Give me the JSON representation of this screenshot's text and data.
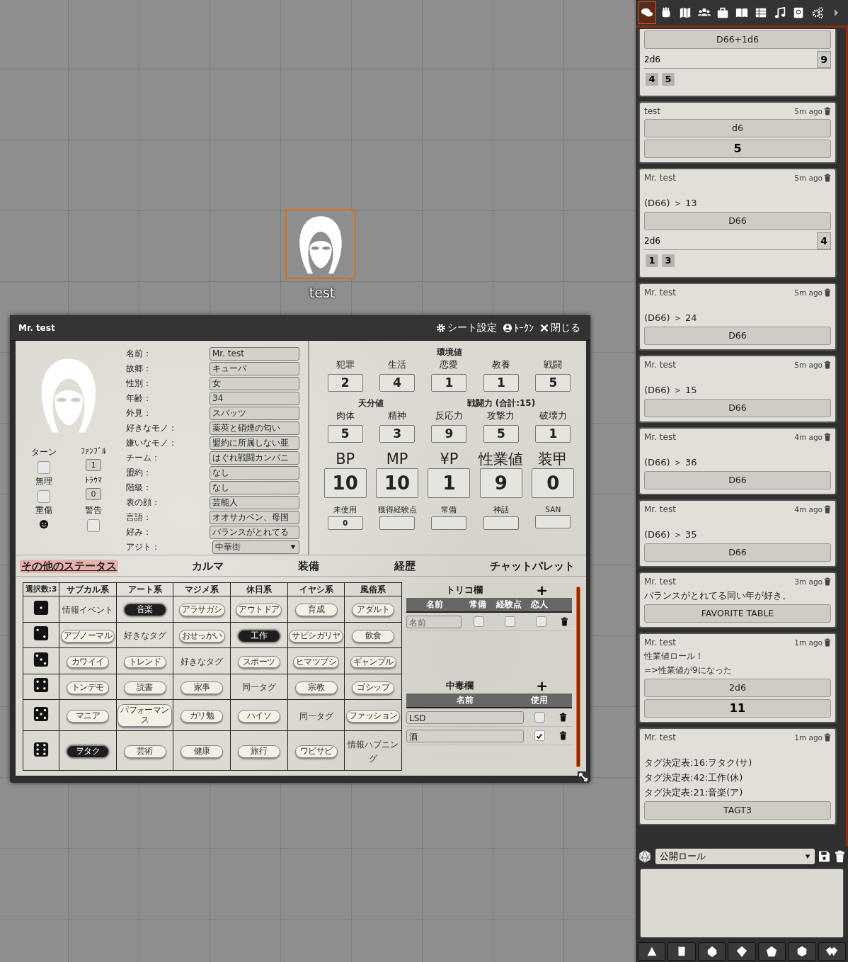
{
  "canvas": {
    "token": {
      "label": "test"
    }
  },
  "sheet": {
    "title": "Mr. test",
    "actions": [
      {
        "kind": "gear",
        "label": "シート設定"
      },
      {
        "kind": "user",
        "label": "ﾄｰｸﾝ"
      },
      {
        "kind": "close",
        "label": "閉じる"
      }
    ],
    "counters": [
      {
        "label": "ターン",
        "kind": "checkbox",
        "checked": false
      },
      {
        "label": "ﾌｧﾝﾌﾞﾙ",
        "kind": "number",
        "value": "1"
      },
      {
        "label": "無理",
        "kind": "checkbox",
        "checked": false
      },
      {
        "label": "ﾄﾗｳﾏ",
        "kind": "number",
        "value": "0"
      },
      {
        "label": "重傷",
        "kind": "icon"
      },
      {
        "label": "警告",
        "kind": "checkbox",
        "checked": false
      }
    ],
    "profile": [
      {
        "label": "名前：",
        "value": "Mr. test",
        "kind": "text"
      },
      {
        "label": "故郷：",
        "value": "キューバ",
        "kind": "text"
      },
      {
        "label": "性別：",
        "value": "女",
        "kind": "text"
      },
      {
        "label": "年齢：",
        "value": "34",
        "kind": "text"
      },
      {
        "label": "外見：",
        "value": "スパッツ",
        "kind": "text"
      },
      {
        "label": "好きなモノ：",
        "value": "薬莢と硝煙の匂い",
        "kind": "text"
      },
      {
        "label": "嫌いなモノ：",
        "value": "盟約に所属しない亜",
        "kind": "text"
      },
      {
        "label": "チーム：",
        "value": "はぐれ戦闘カンパニ",
        "kind": "text"
      },
      {
        "label": "盟約：",
        "value": "なし",
        "kind": "text"
      },
      {
        "label": "階級：",
        "value": "なし",
        "kind": "text"
      },
      {
        "label": "表の顔：",
        "value": "芸能人",
        "kind": "text"
      },
      {
        "label": "言語：",
        "value": "オオサカベン、母国",
        "kind": "text"
      },
      {
        "label": "好み：",
        "value": "バランスがとれてる",
        "kind": "text"
      },
      {
        "label": "アジト：",
        "value": "中華街",
        "kind": "select"
      }
    ],
    "environment": {
      "title": "環境値",
      "stats": [
        {
          "label": "犯罪",
          "value": "2"
        },
        {
          "label": "生活",
          "value": "4"
        },
        {
          "label": "恋愛",
          "value": "1"
        },
        {
          "label": "教養",
          "value": "1"
        },
        {
          "label": "戦闘",
          "value": "5"
        }
      ]
    },
    "aptitude": {
      "title": "天分値",
      "stats": [
        {
          "label": "肉体",
          "value": "5"
        },
        {
          "label": "精神",
          "value": "3"
        }
      ]
    },
    "combat": {
      "title": "戦闘力 (合計:15)",
      "stats": [
        {
          "label": "反応力",
          "value": "9"
        },
        {
          "label": "攻撃力",
          "value": "5"
        },
        {
          "label": "破壊力",
          "value": "1"
        }
      ]
    },
    "points": [
      {
        "label": "BP",
        "value": "10"
      },
      {
        "label": "MP",
        "value": "10"
      },
      {
        "label": "¥P",
        "value": "1"
      },
      {
        "label": "性業値",
        "value": "9"
      },
      {
        "label": "装甲",
        "value": "0"
      }
    ],
    "extras": [
      {
        "label": "未使用",
        "value": "0"
      },
      {
        "label": "獲得経験点"
      },
      {
        "label": "常備"
      },
      {
        "label": "神話"
      },
      {
        "label": "SAN"
      }
    ],
    "tabs": [
      {
        "label": "その他のステータス",
        "selected": true
      },
      {
        "label": "カルマ",
        "selected": false
      },
      {
        "label": "装備",
        "selected": false
      },
      {
        "label": "経歴",
        "selected": false
      },
      {
        "label": "チャットパレット",
        "selected": false
      }
    ],
    "tag_table": {
      "corner": "選択数:3",
      "columns": [
        "サブカル系",
        "アート系",
        "マジメ系",
        "休日系",
        "イヤシ系",
        "風俗系"
      ],
      "rows": [
        [
          {
            "text": "情報イベント",
            "kind": "text"
          },
          {
            "text": "音楽",
            "kind": "tag",
            "selected": true
          },
          {
            "text": "アラサガシ",
            "kind": "tag",
            "selected": false
          },
          {
            "text": "アウトドア",
            "kind": "tag",
            "selected": false
          },
          {
            "text": "育成",
            "kind": "tag",
            "selected": false
          },
          {
            "text": "アダルト",
            "kind": "tag",
            "selected": false
          }
        ],
        [
          {
            "text": "アブノーマル",
            "kind": "tag",
            "selected": false
          },
          {
            "text": "好きなタグ",
            "kind": "text"
          },
          {
            "text": "おせっかい",
            "kind": "tag",
            "selected": false
          },
          {
            "text": "工作",
            "kind": "tag",
            "selected": true
          },
          {
            "text": "サビシガリヤ",
            "kind": "tag",
            "selected": false
          },
          {
            "text": "飲食",
            "kind": "tag",
            "selected": false
          }
        ],
        [
          {
            "text": "カワイイ",
            "kind": "tag",
            "selected": false
          },
          {
            "text": "トレンド",
            "kind": "tag",
            "selected": false
          },
          {
            "text": "好きなタグ",
            "kind": "text"
          },
          {
            "text": "スポーツ",
            "kind": "tag",
            "selected": false
          },
          {
            "text": "ヒマツブシ",
            "kind": "tag",
            "selected": false
          },
          {
            "text": "ギャンブル",
            "kind": "tag",
            "selected": false
          }
        ],
        [
          {
            "text": "トンデモ",
            "kind": "tag",
            "selected": false
          },
          {
            "text": "読書",
            "kind": "tag",
            "selected": false
          },
          {
            "text": "家事",
            "kind": "tag",
            "selected": false
          },
          {
            "text": "同一タグ",
            "kind": "text"
          },
          {
            "text": "宗教",
            "kind": "tag",
            "selected": false
          },
          {
            "text": "ゴシップ",
            "kind": "tag",
            "selected": false
          }
        ],
        [
          {
            "text": "マニア",
            "kind": "tag",
            "selected": false
          },
          {
            "text": "パフォーマンス",
            "kind": "tag",
            "selected": false
          },
          {
            "text": "ガリ勉",
            "kind": "tag",
            "selected": false
          },
          {
            "text": "ハイソ",
            "kind": "tag",
            "selected": false
          },
          {
            "text": "同一タグ",
            "kind": "text"
          },
          {
            "text": "ファッション",
            "kind": "tag",
            "selected": false
          }
        ],
        [
          {
            "text": "ヲタク",
            "kind": "tag",
            "selected": true
          },
          {
            "text": "芸術",
            "kind": "tag",
            "selected": false
          },
          {
            "text": "健康",
            "kind": "tag",
            "selected": false
          },
          {
            "text": "旅行",
            "kind": "tag",
            "selected": false
          },
          {
            "text": "ワビサビ",
            "kind": "tag",
            "selected": false
          },
          {
            "text": "情報ハプニング",
            "kind": "text"
          }
        ]
      ]
    },
    "trico": {
      "title": "トリコ欄",
      "add": "+",
      "columns": [
        "名前",
        "常備",
        "経験点",
        "恋人"
      ],
      "rows": [
        {
          "placeholder": "名前",
          "flags": [
            {
              "checked": false
            },
            {
              "checked": false
            },
            {
              "checked": false
            }
          ]
        }
      ]
    },
    "addiction": {
      "title": "中毒欄",
      "add": "+",
      "columns": [
        "名前",
        "使用"
      ],
      "rows": [
        {
          "value": "LSD",
          "checked": false
        },
        {
          "value": "酒",
          "checked": true
        }
      ]
    }
  },
  "chat": {
    "toolbar": [
      {
        "kind": "chat",
        "selected": true
      },
      {
        "kind": "hand",
        "selected": false
      },
      {
        "kind": "map",
        "selected": false
      },
      {
        "kind": "people",
        "selected": false
      },
      {
        "kind": "briefcase",
        "selected": false
      },
      {
        "kind": "book",
        "selected": false
      },
      {
        "kind": "table",
        "selected": false
      },
      {
        "kind": "music",
        "selected": false
      },
      {
        "kind": "journal",
        "selected": false
      },
      {
        "kind": "gears",
        "selected": false
      },
      {
        "kind": "next",
        "selected": false
      }
    ],
    "messages": [
      {
        "items": [
          {
            "kind": "formula",
            "text": "D66+1d6"
          },
          {
            "kind": "sub",
            "label": "2d6",
            "total": "9",
            "dice": [
              "4",
              "5"
            ]
          }
        ]
      },
      {
        "author": "test",
        "time": "5m ago",
        "items": [
          {
            "kind": "formula",
            "text": "d6"
          },
          {
            "kind": "result",
            "text": "5"
          }
        ]
      },
      {
        "author": "Mr. test",
        "time": "5m ago",
        "items": [
          {
            "kind": "rolltext",
            "text": "(D66) ＞ 13"
          },
          {
            "kind": "formula",
            "text": "D66"
          },
          {
            "kind": "sub",
            "label": "2d6",
            "total": "4",
            "dice": [
              "1",
              "3"
            ]
          }
        ]
      },
      {
        "author": "Mr. test",
        "time": "5m ago",
        "items": [
          {
            "kind": "rolltext",
            "text": "(D66) ＞ 24"
          },
          {
            "kind": "formula",
            "text": "D66"
          }
        ]
      },
      {
        "author": "Mr. test",
        "time": "5m ago",
        "items": [
          {
            "kind": "rolltext",
            "text": "(D66) ＞ 15"
          },
          {
            "kind": "formula",
            "text": "D66"
          }
        ]
      },
      {
        "author": "Mr. test",
        "time": "4m ago",
        "items": [
          {
            "kind": "rolltext",
            "text": "(D66) ＞ 36"
          },
          {
            "kind": "formula",
            "text": "D66"
          }
        ]
      },
      {
        "author": "Mr. test",
        "time": "4m ago",
        "items": [
          {
            "kind": "rolltext",
            "text": "(D66) ＞ 35"
          },
          {
            "kind": "formula",
            "text": "D66"
          }
        ]
      },
      {
        "author": "Mr. test",
        "time": "3m ago",
        "items": [
          {
            "kind": "text",
            "text": "バランスがとれてる同い年が好き。"
          },
          {
            "kind": "formula",
            "text": "FAVORITE TABLE"
          }
        ]
      },
      {
        "author": "Mr. test",
        "time": "1m ago",
        "items": [
          {
            "kind": "note",
            "text": "性業値ロール！"
          },
          {
            "kind": "note",
            "text": "=>性業値が9になった"
          },
          {
            "kind": "formula",
            "text": "2d6"
          },
          {
            "kind": "result",
            "text": "11"
          }
        ]
      },
      {
        "author": "Mr. test",
        "time": "1m ago",
        "items": [
          {
            "kind": "rolltext",
            "text": "タグ決定表:16:ヲタク(サ)"
          },
          {
            "kind": "rolltext",
            "text": "タグ決定表:42:工作(休)"
          },
          {
            "kind": "rolltext",
            "text": "タグ決定表:21:音楽(ア)"
          },
          {
            "kind": "formula",
            "text": "TAGT3"
          }
        ]
      }
    ],
    "roll_mode": "公開ロール"
  }
}
